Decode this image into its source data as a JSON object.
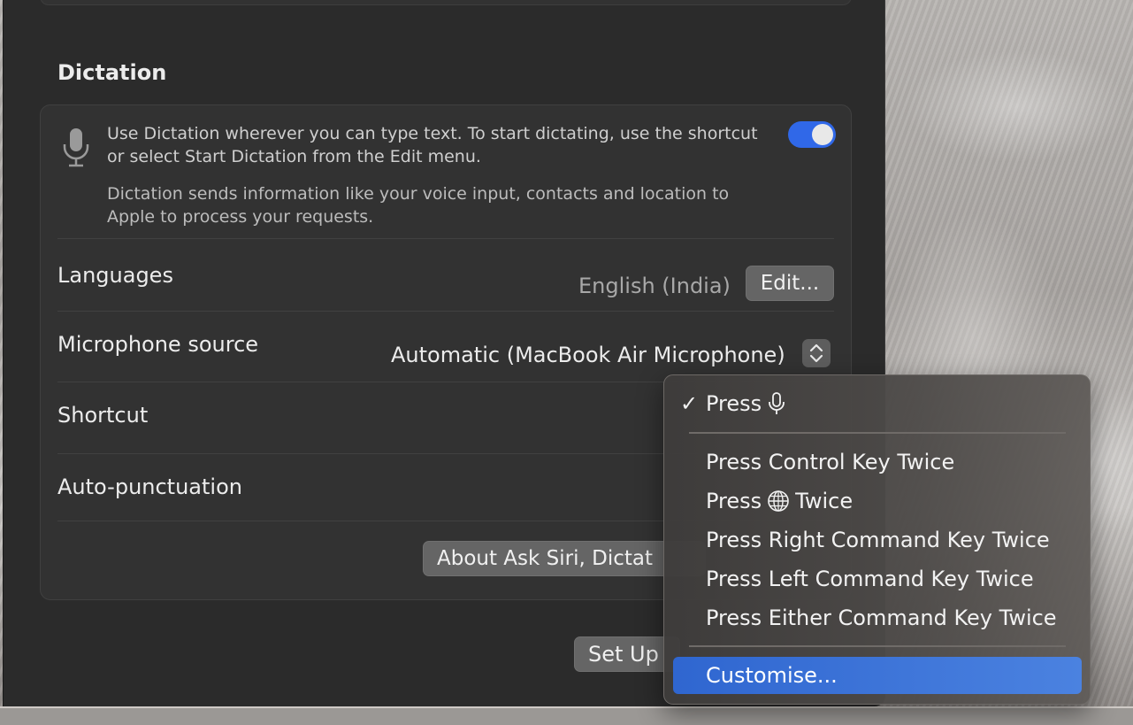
{
  "dictation": {
    "section_title": "Dictation",
    "description": "Use Dictation wherever you can type text. To start dictating, use the shortcut or select Start Dictation from the Edit menu.",
    "privacy_note": "Dictation sends information like your voice input, contacts and location to Apple to process your requests.",
    "enabled": true,
    "languages": {
      "label": "Languages",
      "value": "English (India)",
      "edit_label": "Edit..."
    },
    "microphone": {
      "label": "Microphone source",
      "value": "Automatic (MacBook Air Microphone)"
    },
    "shortcut": {
      "label": "Shortcut"
    },
    "auto_punctuation": {
      "label": "Auto-punctuation"
    },
    "about_button_label": "About Ask Siri, Dictat",
    "setup_button_label": "Set Up"
  },
  "shortcut_menu": {
    "items": [
      {
        "label": "Press",
        "icon": "microphone-icon",
        "checked": true
      },
      {
        "label": "Press Control Key Twice"
      },
      {
        "label_before": "Press",
        "icon": "globe-icon",
        "label_after": "Twice"
      },
      {
        "label": "Press Right Command Key Twice"
      },
      {
        "label": "Press Left Command Key Twice"
      },
      {
        "label": "Press Either Command Key Twice"
      },
      {
        "label": "Customise...",
        "highlighted": true
      }
    ],
    "check_glyph": "✓"
  },
  "colors": {
    "toggle_on": "#3068e8",
    "menu_highlight": "#3a72d8"
  }
}
